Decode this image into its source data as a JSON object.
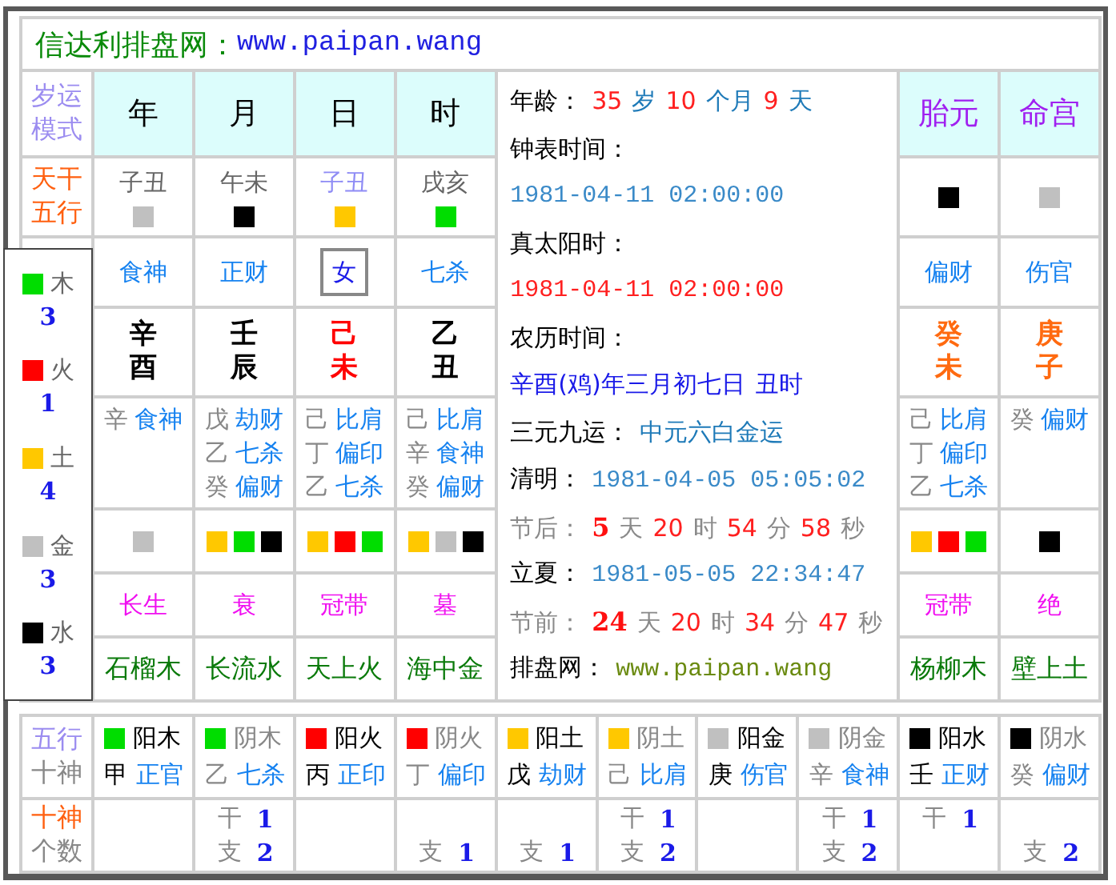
{
  "title": {
    "site": "信达利排盘网：",
    "url": "www.paipan.wang"
  },
  "row_labels": [
    {
      "lines": [
        {
          "text": "岁运",
          "kind": "purple"
        },
        {
          "text": "模式",
          "kind": "purple"
        }
      ]
    },
    {
      "lines": [
        {
          "text": "天干",
          "kind": "orange"
        },
        {
          "text": "五行",
          "kind": "orange"
        }
      ]
    }
  ],
  "pillars": [
    {
      "kind": "pillar",
      "header": "年",
      "kongwang": "子丑",
      "color": "#c0c0c0",
      "god": "食神",
      "stem": "辛",
      "branch": "酉",
      "hidden": [
        {
          "stem": "辛",
          "god": "食神"
        }
      ],
      "branch_elements": [
        {
          "color": "#c0c0c0"
        }
      ],
      "phase": "长生",
      "nayin": "石榴木"
    },
    {
      "kind": "pillar",
      "header": "月",
      "kongwang": "午未",
      "color": "#000000",
      "god": "正财",
      "stem": "壬",
      "branch": "辰",
      "hidden": [
        {
          "stem": "戊",
          "god": "劫财"
        },
        {
          "stem": "乙",
          "god": "七杀"
        },
        {
          "stem": "癸",
          "god": "偏财"
        }
      ],
      "branch_elements": [
        {
          "color": "#ffc800"
        },
        {
          "color": "#00dd00"
        },
        {
          "color": "#000000"
        }
      ],
      "phase": "衰",
      "nayin": "长流水"
    },
    {
      "kind": "day",
      "header": "日",
      "kongwang": "子丑",
      "color": "#ffc800",
      "god": "女",
      "stem": "己",
      "branch": "未",
      "hidden": [
        {
          "stem": "己",
          "god": "比肩"
        },
        {
          "stem": "丁",
          "god": "偏印"
        },
        {
          "stem": "乙",
          "god": "七杀"
        }
      ],
      "branch_elements": [
        {
          "color": "#ffc800"
        },
        {
          "color": "#ff0000"
        },
        {
          "color": "#00dd00"
        }
      ],
      "phase": "冠带",
      "nayin": "天上火"
    },
    {
      "kind": "pillar",
      "header": "时",
      "kongwang": "戌亥",
      "color": "#00dd00",
      "god": "七杀",
      "stem": "乙",
      "branch": "丑",
      "hidden": [
        {
          "stem": "己",
          "god": "比肩"
        },
        {
          "stem": "辛",
          "god": "食神"
        },
        {
          "stem": "癸",
          "god": "偏财"
        }
      ],
      "branch_elements": [
        {
          "color": "#ffc800"
        },
        {
          "color": "#c0c0c0"
        },
        {
          "color": "#000000"
        }
      ],
      "phase": "墓",
      "nayin": "海中金"
    },
    {
      "kind": "extra",
      "header": "胎元",
      "color": "#000000",
      "god": "偏财",
      "stem": "癸",
      "branch": "未",
      "hidden": [
        {
          "stem": "己",
          "god": "比肩"
        },
        {
          "stem": "丁",
          "god": "偏印"
        },
        {
          "stem": "乙",
          "god": "七杀"
        }
      ],
      "branch_elements": [
        {
          "color": "#ffc800"
        },
        {
          "color": "#ff0000"
        },
        {
          "color": "#00dd00"
        }
      ],
      "phase": "冠带",
      "nayin": "杨柳木"
    },
    {
      "kind": "extra",
      "header": "命宫",
      "color": "#c0c0c0",
      "god": "伤官",
      "stem": "庚",
      "branch": "子",
      "hidden": [
        {
          "stem": "癸",
          "god": "偏财"
        }
      ],
      "branch_elements": [
        {
          "color": "#000000"
        }
      ],
      "phase": "绝",
      "nayin": "壁上土"
    }
  ],
  "info": [
    [
      {
        "text": "年龄：",
        "kind": "label"
      },
      {
        "text": "35",
        "kind": "num"
      },
      {
        "text": "岁",
        "kind": "unit"
      },
      {
        "text": "10",
        "kind": "num"
      },
      {
        "text": "个月",
        "kind": "unit"
      },
      {
        "text": "9",
        "kind": "num"
      },
      {
        "text": "天",
        "kind": "unit"
      }
    ],
    [
      {
        "text": "钟表时间：",
        "kind": "label"
      }
    ],
    [
      {
        "text": "1981-04-11 02:00:00",
        "kind": "date"
      }
    ],
    [
      {
        "text": "真太阳时：",
        "kind": "label"
      }
    ],
    [
      {
        "text": "1981-04-11 02:00:00",
        "kind": "reddate"
      }
    ],
    [
      {
        "text": "农历时间：",
        "kind": "label"
      }
    ],
    [
      {
        "text": "辛酉(鸡)年三月初七日",
        "kind": "lunar"
      },
      {
        "text": "丑时",
        "kind": "lunar"
      }
    ],
    [
      {
        "text": "三元九运：",
        "kind": "label"
      },
      {
        "text": "中元六白金运",
        "kind": "unit"
      }
    ],
    [
      {
        "text": "清明：",
        "kind": "label"
      },
      {
        "text": "1981-04-05 05:05:02",
        "kind": "date"
      }
    ],
    [
      {
        "text": "节后：",
        "kind": "muted"
      },
      {
        "text": "5",
        "kind": "bold"
      },
      {
        "text": "天",
        "kind": "muted"
      },
      {
        "text": "20",
        "kind": "num"
      },
      {
        "text": "时",
        "kind": "muted"
      },
      {
        "text": "54",
        "kind": "num"
      },
      {
        "text": "分",
        "kind": "muted"
      },
      {
        "text": "58",
        "kind": "num"
      },
      {
        "text": "秒",
        "kind": "muted"
      }
    ],
    [
      {
        "text": "立夏：",
        "kind": "label"
      },
      {
        "text": "1981-05-05 22:34:47",
        "kind": "date"
      }
    ],
    [
      {
        "text": "节前：",
        "kind": "muted"
      },
      {
        "text": "24",
        "kind": "bold"
      },
      {
        "text": "天",
        "kind": "muted"
      },
      {
        "text": "20",
        "kind": "num"
      },
      {
        "text": "时",
        "kind": "muted"
      },
      {
        "text": "34",
        "kind": "num"
      },
      {
        "text": "分",
        "kind": "muted"
      },
      {
        "text": "47",
        "kind": "num"
      },
      {
        "text": "秒",
        "kind": "muted"
      }
    ],
    [
      {
        "text": "排盘网：",
        "kind": "label"
      },
      {
        "text": "www.paipan.wang",
        "kind": "link"
      }
    ]
  ],
  "element_totals": [
    {
      "name": "木",
      "color": "#00dd00",
      "count": "3"
    },
    {
      "name": "火",
      "color": "#ff0000",
      "count": "1"
    },
    {
      "name": "土",
      "color": "#ffc800",
      "count": "4"
    },
    {
      "name": "金",
      "color": "#c0c0c0",
      "count": "3"
    },
    {
      "name": "水",
      "color": "#000000",
      "count": "3"
    }
  ],
  "bottom_labels": [
    {
      "lines": [
        {
          "text": "五行",
          "kind": "purple"
        },
        {
          "text": "十神",
          "kind": "gray"
        }
      ]
    },
    {
      "lines": [
        {
          "text": "十神",
          "kind": "orange"
        },
        {
          "text": "个数",
          "kind": "gray"
        }
      ]
    }
  ],
  "stems": [
    {
      "yinyang": "阳木",
      "yang": true,
      "color": "#00dd00",
      "stem": "甲",
      "god": "正官"
    },
    {
      "yinyang": "阴木",
      "yang": false,
      "color": "#00dd00",
      "stem": "乙",
      "god": "七杀",
      "gan": {
        "label": "干",
        "value": "1"
      },
      "zhi": {
        "label": "支",
        "value": "2"
      }
    },
    {
      "yinyang": "阳火",
      "yang": true,
      "color": "#ff0000",
      "stem": "丙",
      "god": "正印"
    },
    {
      "yinyang": "阴火",
      "yang": false,
      "color": "#ff0000",
      "stem": "丁",
      "god": "偏印",
      "zhi": {
        "label": "支",
        "value": "1"
      }
    },
    {
      "yinyang": "阳土",
      "yang": true,
      "color": "#ffc800",
      "stem": "戊",
      "god": "劫财",
      "zhi": {
        "label": "支",
        "value": "1"
      }
    },
    {
      "yinyang": "阴土",
      "yang": false,
      "color": "#ffc800",
      "stem": "己",
      "god": "比肩",
      "gan": {
        "label": "干",
        "value": "1"
      },
      "zhi": {
        "label": "支",
        "value": "2"
      }
    },
    {
      "yinyang": "阳金",
      "yang": true,
      "color": "#c0c0c0",
      "stem": "庚",
      "god": "伤官"
    },
    {
      "yinyang": "阴金",
      "yang": false,
      "color": "#c0c0c0",
      "stem": "辛",
      "god": "食神",
      "gan": {
        "label": "干",
        "value": "1"
      },
      "zhi": {
        "label": "支",
        "value": "2"
      }
    },
    {
      "yinyang": "阳水",
      "yang": true,
      "color": "#000000",
      "stem": "壬",
      "god": "正财",
      "gan": {
        "label": "干",
        "value": "1"
      }
    },
    {
      "yinyang": "阴水",
      "yang": false,
      "color": "#000000",
      "stem": "癸",
      "god": "偏财",
      "zhi": {
        "label": "支",
        "value": "2"
      }
    }
  ]
}
